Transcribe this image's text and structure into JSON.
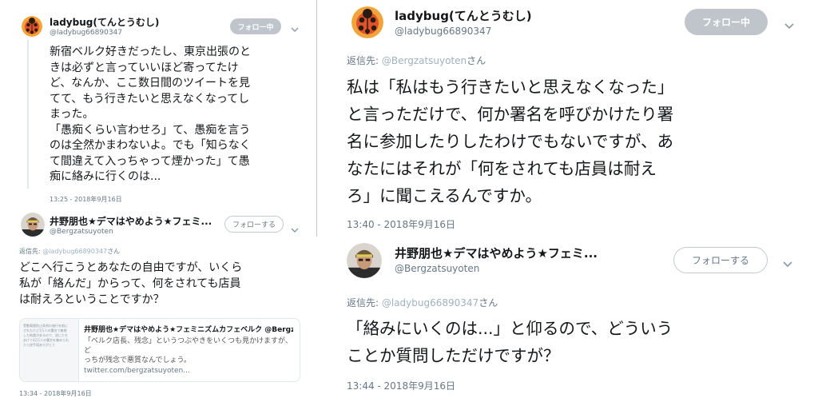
{
  "left_panel": {
    "tweet1": {
      "name": "ladybug(てんとうむし)",
      "handle": "@ladybug66890347",
      "follow_button": "フォロー中",
      "text": "新宿ベルク好きだったし、東京出張のと\nきは必ずと言っていいほど寄ってたけ\nど、なんか、ここ数日間のツイートを見\nてて、もう行きたいと思えなくなってし\nまった。\n「愚痴くらい言わせろ」て、愚痴を言う\nのは全然かまわないよ。でも「知らなく\nて間違えて入っちゃって煙かった」て愚\n痴に絡みに行くのは...",
      "timestamp": "13:25 - 2018年9月16日"
    },
    "tweet2": {
      "name": "井野朋也★デマはやめよう★フェミ...",
      "handle": "@Bergzatsuyoten",
      "follow_button": "フォローする",
      "reply_prefix": "返信先: ",
      "reply_to": "@ladybug66890347",
      "reply_suffix": "さん",
      "text": "どこへ行こうとあなたの自由ですが、いくら\n私が「絡んだ」からって、何をされても店員\nは耐えろということですか？",
      "card": {
        "thumb_text": "受動喫煙防止条例の施行を前に\nされたけど1万人の署名で無視\nした結論があるので、逆にたち\nあげて42万人の署名を集められ\nたら逆手段ありがとう",
        "title": "井野朋也★デマはやめよう★フェミニズムカフェベルク @Bergz...",
        "desc": "「ベルク店長、残念」というつぶやきをいくつも見かけますが、ど\nっちが残念で悪質なんでしょう。",
        "link": "twitter.com/bergzatsuyoten..."
      },
      "timestamp": "13:34 - 2018年9月16日"
    }
  },
  "right_panel": {
    "tweet1": {
      "name": "ladybug(てんとうむし)",
      "handle": "@ladybug66890347",
      "follow_button": "フォロー中",
      "reply_prefix": "返信先: ",
      "reply_to": "@Bergzatsuyoten",
      "reply_suffix": "さん",
      "text": "私は「私はもう行きたいと思えなくなった」\nと言っただけで、何か署名を呼びかけたり署\n名に参加したりしたわけでもないですが、あ\nなたにはそれが「何をされても店員は耐え\nろ」に聞こえるんですか。",
      "timestamp": "13:40 - 2018年9月16日"
    },
    "tweet2": {
      "name": "井野朋也★デマはやめよう★フェミ...",
      "handle": "@Bergzatsuyoten",
      "follow_button": "フォローする",
      "reply_prefix": "返信先: ",
      "reply_to": "@ladybug66890347",
      "reply_suffix": "さん",
      "text": "「絡みにいくのは...」と仰るので、どういう\nことか質問しただけですが？",
      "timestamp": "13:44 - 2018年9月16日"
    }
  },
  "icons": {
    "chevron": "chevron-down-icon",
    "ladybug_avatar": "ladybug-avatar",
    "person_avatar": "person-avatar"
  },
  "colors": {
    "following_button": "#bfc5cb",
    "secondary_text": "#657786",
    "primary_text": "#14171a"
  }
}
